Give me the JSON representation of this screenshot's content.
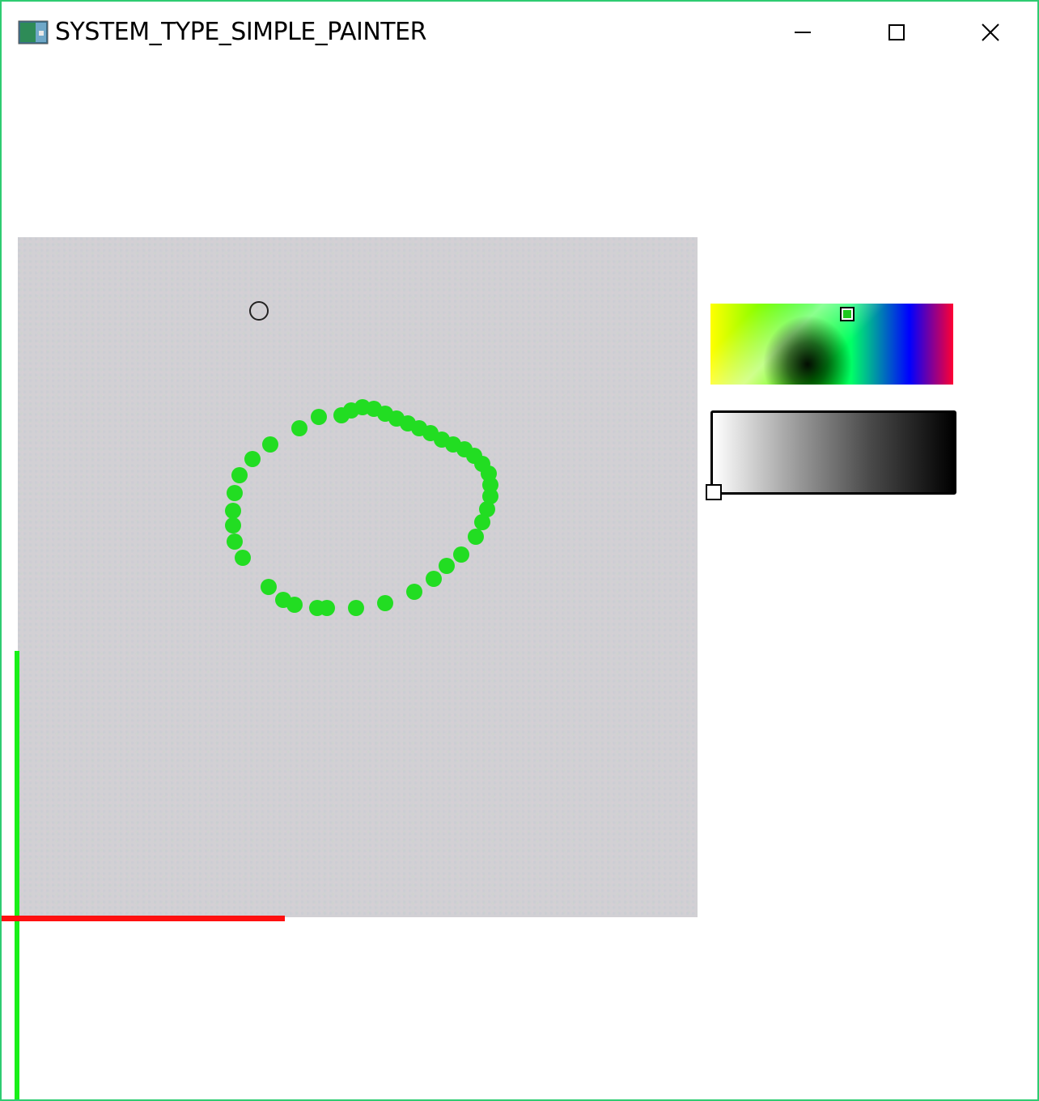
{
  "window": {
    "title": "SYSTEM_TYPE_SIMPLE_PAINTER",
    "border_color": "#2ecc71"
  },
  "titlebar_buttons": {
    "minimize_icon": "minimize-icon",
    "maximize_icon": "maximize-icon",
    "close_icon": "close-icon"
  },
  "canvas": {
    "background_color": "#d2d0d4",
    "stroke_color": "#22dd22",
    "cursor_icon": "circle-cursor-icon"
  },
  "color_picker": {
    "selected_color": "#1ec81e",
    "gray_level": 0
  },
  "indicators": {
    "vertical_color": "#19f019",
    "horizontal_color": "#ff1010"
  }
}
